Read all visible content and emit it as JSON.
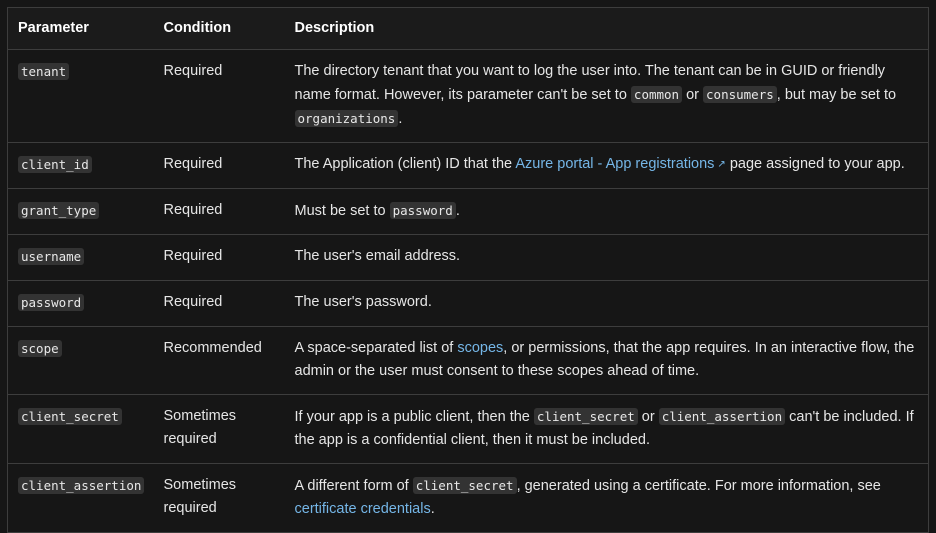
{
  "headers": {
    "parameter": "Parameter",
    "condition": "Condition",
    "description": "Description"
  },
  "rows": [
    {
      "param": "tenant",
      "condition": "Required",
      "desc": {
        "t1": "The directory tenant that you want to log the user into. The tenant can be in GUID or friendly name format. However, its parameter can't be set to ",
        "c1": "common",
        "t2": " or ",
        "c2": "consumers",
        "t3": ", but may be set to ",
        "c3": "organizations",
        "t4": "."
      }
    },
    {
      "param": "client_id",
      "condition": "Required",
      "desc": {
        "t1": "The Application (client) ID that the ",
        "link": "Azure portal - App registrations",
        "t2": " page assigned to your app."
      }
    },
    {
      "param": "grant_type",
      "condition": "Required",
      "desc": {
        "t1": "Must be set to ",
        "c1": "password",
        "t2": "."
      }
    },
    {
      "param": "username",
      "condition": "Required",
      "desc": {
        "t1": "The user's email address."
      }
    },
    {
      "param": "password",
      "condition": "Required",
      "desc": {
        "t1": "The user's password."
      }
    },
    {
      "param": "scope",
      "condition": "Recommended",
      "desc": {
        "t1": "A space-separated list of ",
        "link": "scopes",
        "t2": ", or permissions, that the app requires. In an interactive flow, the admin or the user must consent to these scopes ahead of time."
      }
    },
    {
      "param": "client_secret",
      "condition": "Sometimes required",
      "desc": {
        "t1": "If your app is a public client, then the ",
        "c1": "client_secret",
        "t2": " or ",
        "c2": "client_assertion",
        "t3": " can't be included. If the app is a confidential client, then it must be included."
      }
    },
    {
      "param": "client_assertion",
      "condition": "Sometimes required",
      "desc": {
        "t1": "A different form of ",
        "c1": "client_secret",
        "t2": ", generated using a certificate. For more information, see ",
        "link": "certificate credentials",
        "t3": "."
      }
    }
  ],
  "icons": {
    "external_link": "external-link-icon"
  },
  "colors": {
    "link": "#75b6e7",
    "background": "#161616",
    "code_bg": "#333333"
  }
}
